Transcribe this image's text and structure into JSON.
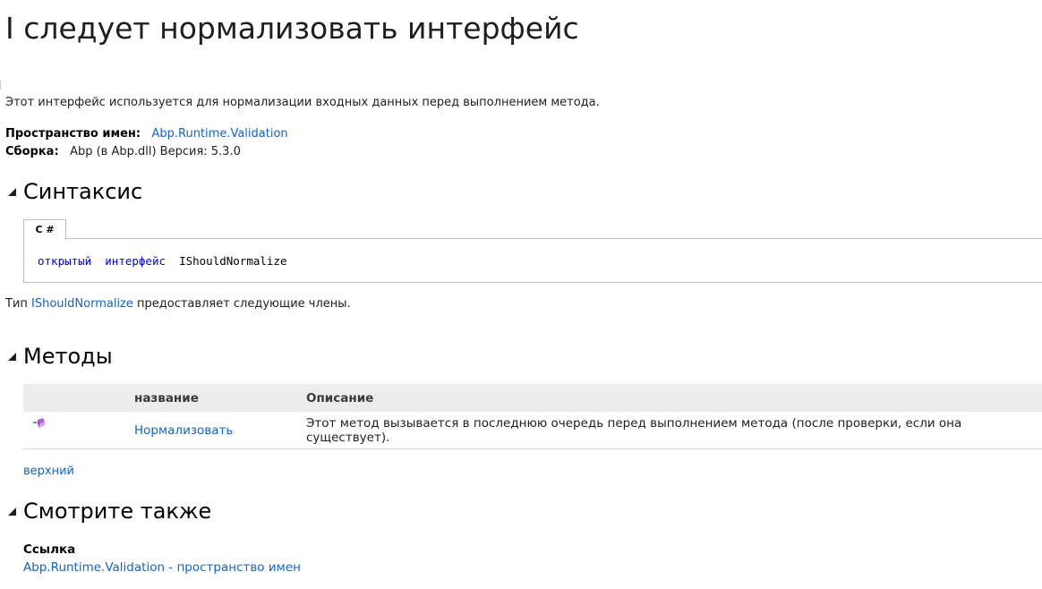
{
  "page": {
    "title": "I следует нормализовать интерфейс",
    "summary": "Этот интерфейс используется для нормализации входных данных перед выполнением метода.",
    "namespace_label": "Пространство имен:",
    "namespace_value": "Abp.Runtime.Validation",
    "assembly_label": "Сборка:",
    "assembly_value": "Abp (в Abp.dll) Версия: 5.3.0"
  },
  "syntax": {
    "heading": "Синтаксис",
    "tab_label": "C #",
    "code_kw1": "открытый",
    "code_kw2": "интерфейс",
    "code_name": "IShouldNormalize"
  },
  "members_note": {
    "prefix": "Тип ",
    "type_link": "IShouldNormalize",
    "suffix": " предоставляет следующие члены."
  },
  "methods": {
    "heading": "Методы",
    "columns": [
      "название",
      "Описание"
    ],
    "rows": [
      {
        "icon": "public-method-icon",
        "name": "Нормализовать",
        "description": "Этот метод вызывается в последнюю очередь перед выполнением метода (после проверки, если она существует)."
      }
    ],
    "top_link": "верхний"
  },
  "see_also": {
    "heading": "Смотрите также",
    "reference_label": "Ссылка",
    "reference_link": "Abp.Runtime.Validation - пространство имен"
  },
  "colors": {
    "link": "#1364c4",
    "keyword": "#0000ff",
    "table_header_bg": "#ececec"
  }
}
